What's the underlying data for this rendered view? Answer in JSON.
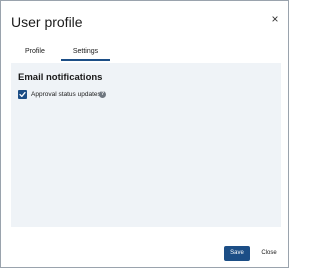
{
  "dialog": {
    "title": "User profile",
    "close_glyph": "×"
  },
  "tabs": [
    {
      "label": "Profile",
      "active": false
    },
    {
      "label": "Settings",
      "active": true
    }
  ],
  "settings": {
    "section_title": "Email notifications",
    "options": [
      {
        "label": "Approval status updates",
        "checked": true
      }
    ],
    "help_glyph": "?"
  },
  "footer": {
    "save_label": "Save",
    "close_label": "Close"
  },
  "colors": {
    "accent": "#1c4e86",
    "panel_bg": "#eff3f7"
  }
}
